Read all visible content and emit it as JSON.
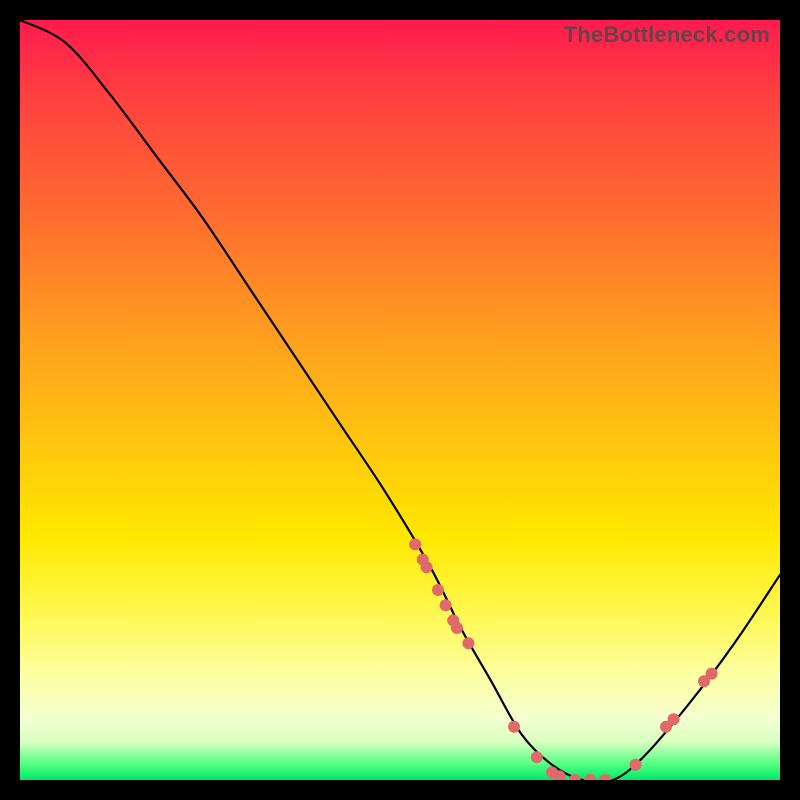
{
  "watermark": "TheBottleneck.com",
  "chart_data": {
    "type": "line",
    "title": "",
    "xlabel": "",
    "ylabel": "",
    "xlim": [
      0,
      100
    ],
    "ylim": [
      0,
      100
    ],
    "grid": false,
    "legend": false,
    "series": [
      {
        "name": "curve",
        "x": [
          0,
          6,
          12,
          18,
          24,
          30,
          36,
          42,
          48,
          54,
          58,
          62,
          66,
          70,
          74,
          78,
          82,
          88,
          94,
          100
        ],
        "y": [
          100,
          97,
          90,
          82,
          74,
          65,
          56,
          47,
          38,
          28,
          20,
          13,
          6,
          2,
          0,
          0,
          3,
          10,
          18,
          27
        ]
      }
    ],
    "points": {
      "name": "markers",
      "x": [
        52,
        53,
        53.5,
        55,
        56,
        57,
        57.5,
        59,
        65,
        68,
        70,
        71,
        73,
        75,
        77,
        81,
        85,
        86,
        90,
        91
      ],
      "y": [
        31,
        29,
        28,
        25,
        23,
        21,
        20,
        18,
        7,
        3,
        1,
        0.5,
        0,
        0,
        0,
        2,
        7,
        8,
        13,
        14
      ]
    },
    "colors": {
      "curve": "#000000",
      "markers": "#e06a6a"
    }
  }
}
